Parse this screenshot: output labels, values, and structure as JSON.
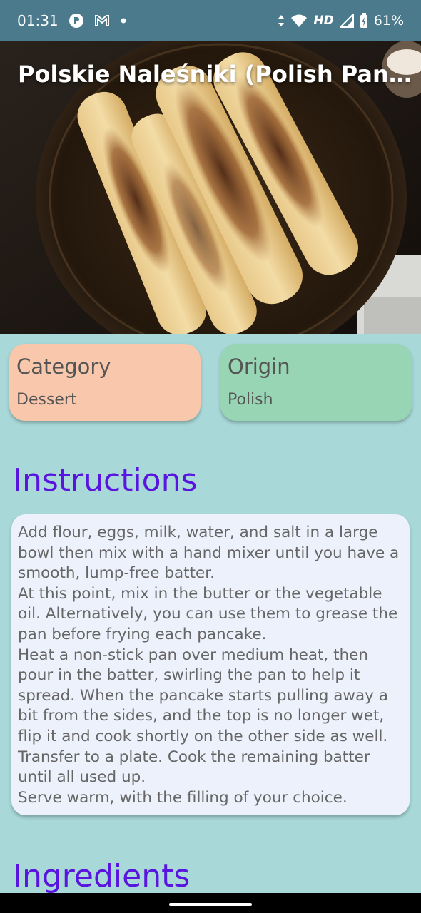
{
  "status_bar": {
    "time": "01:31",
    "network_type": "HD",
    "battery": "61%",
    "icons": [
      "app-notification-icon",
      "gmail-icon",
      "dot-icon",
      "data-arrows-icon",
      "wifi-icon",
      "signal-icon",
      "battery-icon"
    ]
  },
  "header": {
    "title": "Polskie Naleśniki (Polish Pancakes)"
  },
  "category_card": {
    "label": "Category",
    "value": "Dessert"
  },
  "origin_card": {
    "label": "Origin",
    "value": "Polish"
  },
  "instructions": {
    "title": "Instructions",
    "steps": [
      "Add flour, eggs, milk, water, and salt in a large bowl then mix with a hand mixer until you have a smooth, lump-free batter.",
      "At this point, mix in the butter or the vegetable oil. Alternatively, you can use them to grease the pan before frying each pancake.",
      "Heat a non-stick pan over medium heat, then pour in the batter, swirling the pan to help it spread. When the pancake starts pulling away a bit from the sides, and the top is no longer wet, flip it and cook shortly on the other side as well.",
      "Transfer to a plate. Cook the remaining batter until all used up.",
      "Serve warm, with the filling of your choice."
    ]
  },
  "ingredients": {
    "title": "Ingredients"
  },
  "colors": {
    "status_bar": "#4a7a8c",
    "background": "#a8d8d8",
    "category_card": "#f9c8ac",
    "origin_card": "#98d5b4",
    "section_title": "#5a14e0",
    "instructions_box": "#edf1fb"
  }
}
